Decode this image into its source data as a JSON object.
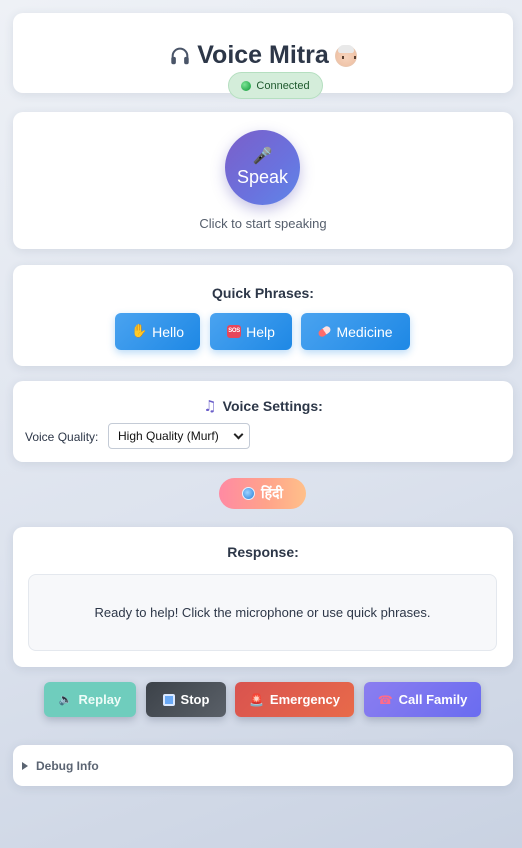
{
  "header": {
    "title": "Voice Mitra",
    "title_left_icon": "headphones-icon",
    "title_right_icon": "old-man-face-icon",
    "status": "Connected",
    "status_color": "#2eae52"
  },
  "speak": {
    "icon": "microphone-icon",
    "mic_glyph": "🎤",
    "label": "Speak",
    "hint": "Click to start speaking",
    "accent": "#6a72de"
  },
  "quick_phrases": {
    "heading": "Quick Phrases:",
    "items": [
      {
        "icon": "waving-hand-icon",
        "label": "Hello"
      },
      {
        "icon": "sos-icon",
        "label": "Help"
      },
      {
        "icon": "pill-icon",
        "label": "Medicine"
      }
    ],
    "color": "#1e88e5"
  },
  "voice_settings": {
    "heading": "Voice Settings:",
    "heading_icon": "music-note-icon",
    "quality_label": "Voice Quality:",
    "quality_value": "High Quality (Murf)"
  },
  "language": {
    "icon": "globe-icon",
    "label": "हिंदी"
  },
  "response": {
    "heading": "Response:",
    "text": "Ready to help! Click the microphone or use quick phrases."
  },
  "actions": [
    {
      "icon": "speaker-icon",
      "label": "Replay",
      "color": "#6fcdbd"
    },
    {
      "icon": "stop-icon",
      "label": "Stop",
      "color": "#3c4249"
    },
    {
      "icon": "siren-icon",
      "label": "Emergency",
      "color": "#d9534f"
    },
    {
      "icon": "phone-icon",
      "label": "Call Family",
      "color": "#6a6cf0"
    }
  ],
  "debug": {
    "summary": "Debug Info"
  }
}
